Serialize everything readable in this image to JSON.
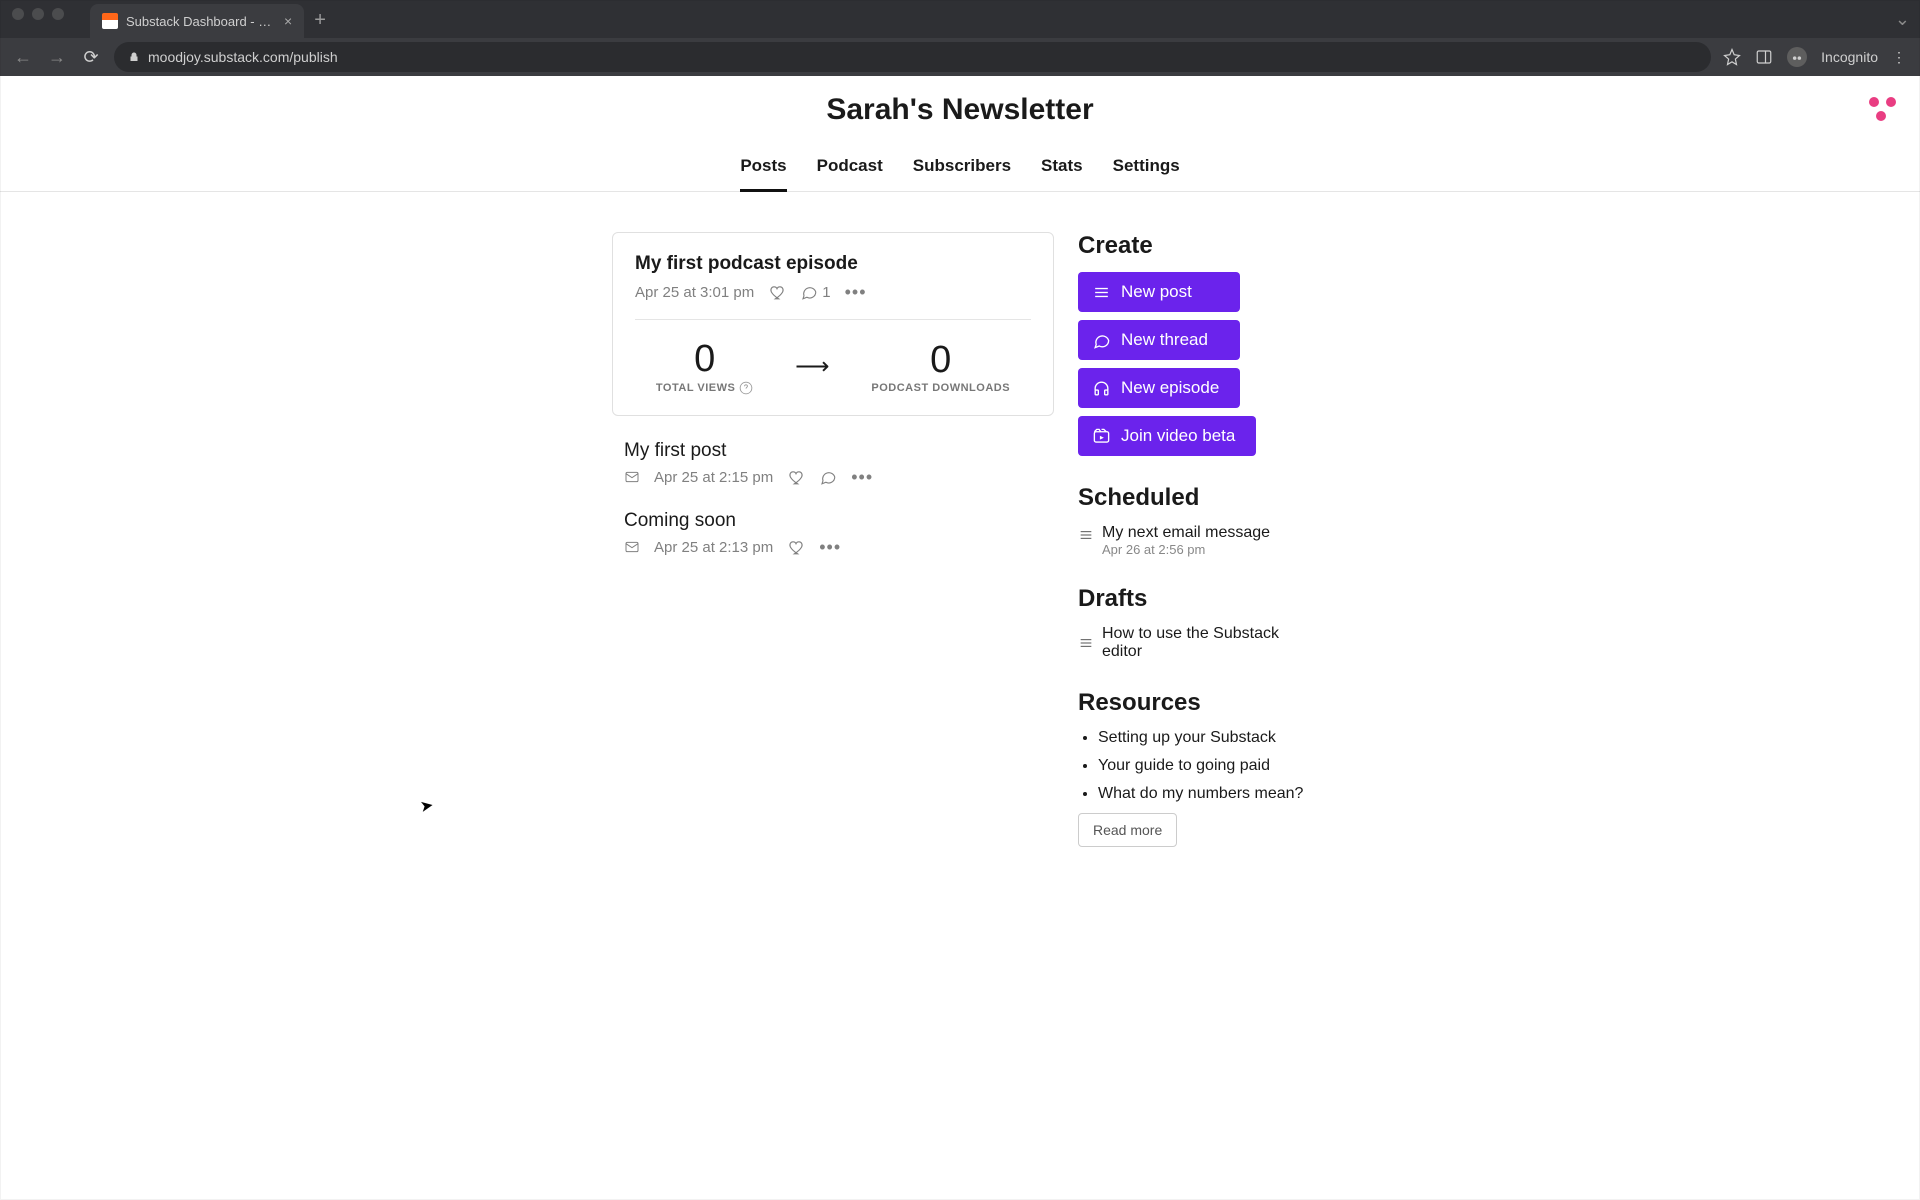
{
  "browser": {
    "tab_title": "Substack Dashboard - Sarah's",
    "url": "moodjoy.substack.com/publish",
    "incognito_label": "Incognito"
  },
  "header": {
    "title": "Sarah's Newsletter"
  },
  "tabs": [
    "Posts",
    "Podcast",
    "Subscribers",
    "Stats",
    "Settings"
  ],
  "posts": {
    "featured": {
      "title": "My first podcast episode",
      "date": "Apr 25 at 3:01 pm",
      "comments": "1",
      "stats": [
        {
          "value": "0",
          "label": "TOTAL VIEWS",
          "help": true
        },
        {
          "value": "0",
          "label": "PODCAST DOWNLOADS"
        }
      ]
    },
    "items": [
      {
        "title": "My first post",
        "date": "Apr 25 at 2:15 pm",
        "has_envelope": true,
        "has_comment": true
      },
      {
        "title": "Coming soon",
        "date": "Apr 25 at 2:13 pm",
        "has_envelope": true,
        "has_comment": false
      }
    ]
  },
  "sidebar": {
    "create": {
      "heading": "Create",
      "buttons": [
        {
          "label": "New post",
          "icon": "lines"
        },
        {
          "label": "New thread",
          "icon": "bubble"
        },
        {
          "label": "New episode",
          "icon": "headphones"
        },
        {
          "label": "Join video beta",
          "icon": "video"
        }
      ]
    },
    "scheduled": {
      "heading": "Scheduled",
      "item_title": "My next email message",
      "item_date": "Apr 26 at 2:56 pm"
    },
    "drafts": {
      "heading": "Drafts",
      "item_title": "How to use the Substack editor"
    },
    "resources": {
      "heading": "Resources",
      "items": [
        "Setting up your Substack",
        "Your guide to going paid",
        "What do my numbers mean?"
      ],
      "read_more": "Read more"
    }
  }
}
